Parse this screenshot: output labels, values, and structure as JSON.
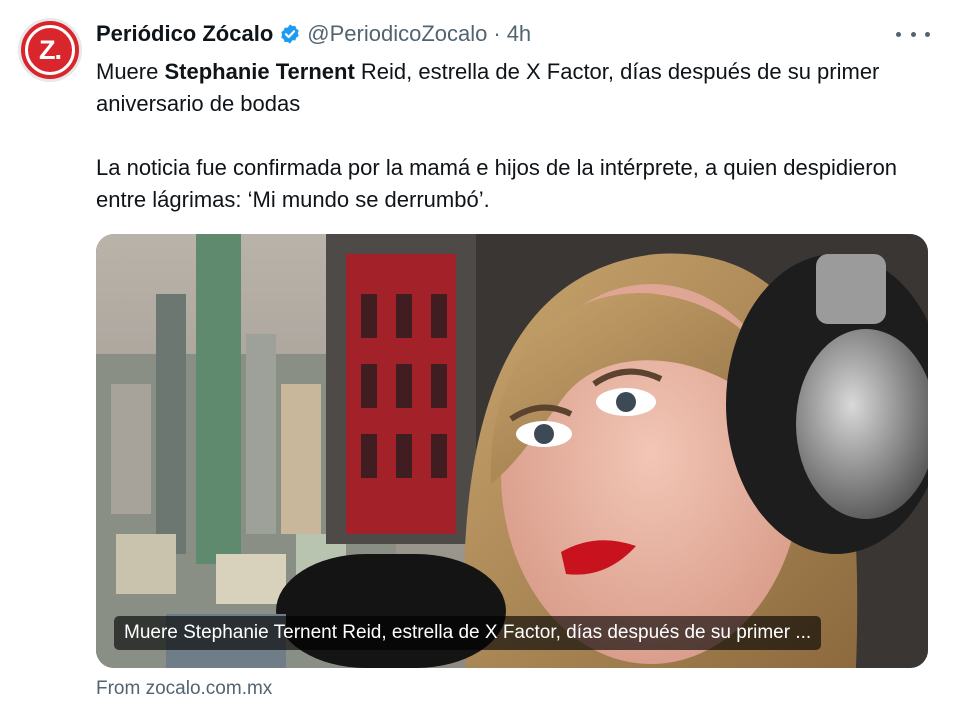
{
  "account": {
    "avatar_text": "Z.",
    "display_name": "Periódico Zócalo",
    "handle": "@PeriodicoZocalo",
    "separator": "·",
    "time": "4h"
  },
  "tweet": {
    "line1_before": "Muere ",
    "line1_bold": "Stephanie Ternent",
    "line1_after": " Reid, estrella de X Factor, días después de su primer aniversario de bodas",
    "paragraph2": "La noticia fue confirmada por la mamá e hijos de la intérprete, a quien despidieron entre lágrimas: ‘Mi mundo se derrumbó’."
  },
  "card": {
    "caption": "Muere Stephanie Ternent Reid, estrella de X Factor, días después de su primer ...",
    "source": "From zocalo.com.mx"
  },
  "icons": {
    "verified": "verified-badge-icon",
    "more": "more-options-icon"
  },
  "colors": {
    "brand_red": "#d9262c",
    "verified_blue": "#1d9bf0",
    "muted": "#536471"
  }
}
